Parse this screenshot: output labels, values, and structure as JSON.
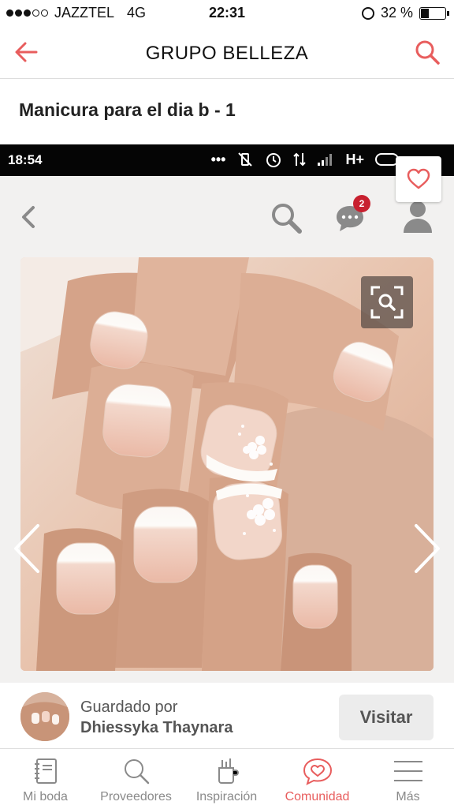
{
  "status_bar": {
    "carrier": "JAZZTEL",
    "network": "4G",
    "time": "22:31",
    "battery": "32 %"
  },
  "navbar": {
    "title": "GRUPO BELLEZA",
    "back_icon": "back-arrow-icon",
    "search_icon": "search-icon",
    "accent_color": "#e85d5d"
  },
  "post": {
    "title": "Manicura para el dia b - 1"
  },
  "embedded_screenshot": {
    "status_time": "18:54",
    "status_network": "H+",
    "chat_badge": "2"
  },
  "saved_by": {
    "label": "Guardado por",
    "name": "Dhiessyka Thaynara",
    "visit_label": "Visitar"
  },
  "tabs": [
    {
      "label": "Mi boda",
      "icon": "notebook-icon"
    },
    {
      "label": "Proveedores",
      "icon": "search-icon"
    },
    {
      "label": "Inspiración",
      "icon": "inspiration-icon"
    },
    {
      "label": "Comunidad",
      "icon": "community-heart-icon",
      "active": true
    },
    {
      "label": "Más",
      "icon": "menu-icon"
    }
  ]
}
